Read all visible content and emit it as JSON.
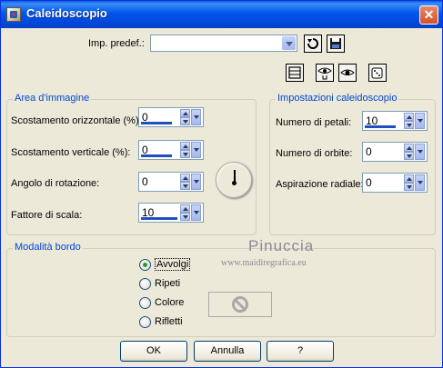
{
  "window": {
    "title": "Caleidoscopio",
    "close_label": "✕"
  },
  "preset": {
    "label": "Imp. predef.:",
    "value": ""
  },
  "area": {
    "title": "Area d'immagine",
    "fields": [
      {
        "label": "Scostamento orizzontale (%):",
        "value": "0"
      },
      {
        "label": "Scostamento verticale (%):",
        "value": "0"
      },
      {
        "label": "Angolo di rotazione:",
        "value": "0"
      },
      {
        "label": "Fattore di scala:",
        "value": "10"
      }
    ]
  },
  "kaleido": {
    "title": "Impostazioni caleidoscopio",
    "fields": [
      {
        "label": "Numero di petali:",
        "value": "10"
      },
      {
        "label": "Numero di orbite:",
        "value": "0"
      },
      {
        "label": "Aspirazione radiale:",
        "value": "0"
      }
    ]
  },
  "border": {
    "title": "Modalità bordo",
    "options": [
      {
        "label": "Avvolgi",
        "selected": true
      },
      {
        "label": "Ripeti",
        "selected": false
      },
      {
        "label": "Colore",
        "selected": false
      },
      {
        "label": "Rifletti",
        "selected": false
      }
    ]
  },
  "watermark": {
    "name": "Pinuccia",
    "url": "www.maidiregrafica.eu"
  },
  "buttons": {
    "ok": "OK",
    "cancel": "Annulla",
    "help": "?"
  },
  "icons": [
    "app-icon",
    "reset-arrow-icon",
    "save-disk-icon",
    "layout-icon",
    "eye-hand-icon",
    "eye-icon",
    "dice-icon",
    "no-color-icon",
    "rotation-dial-icon"
  ]
}
